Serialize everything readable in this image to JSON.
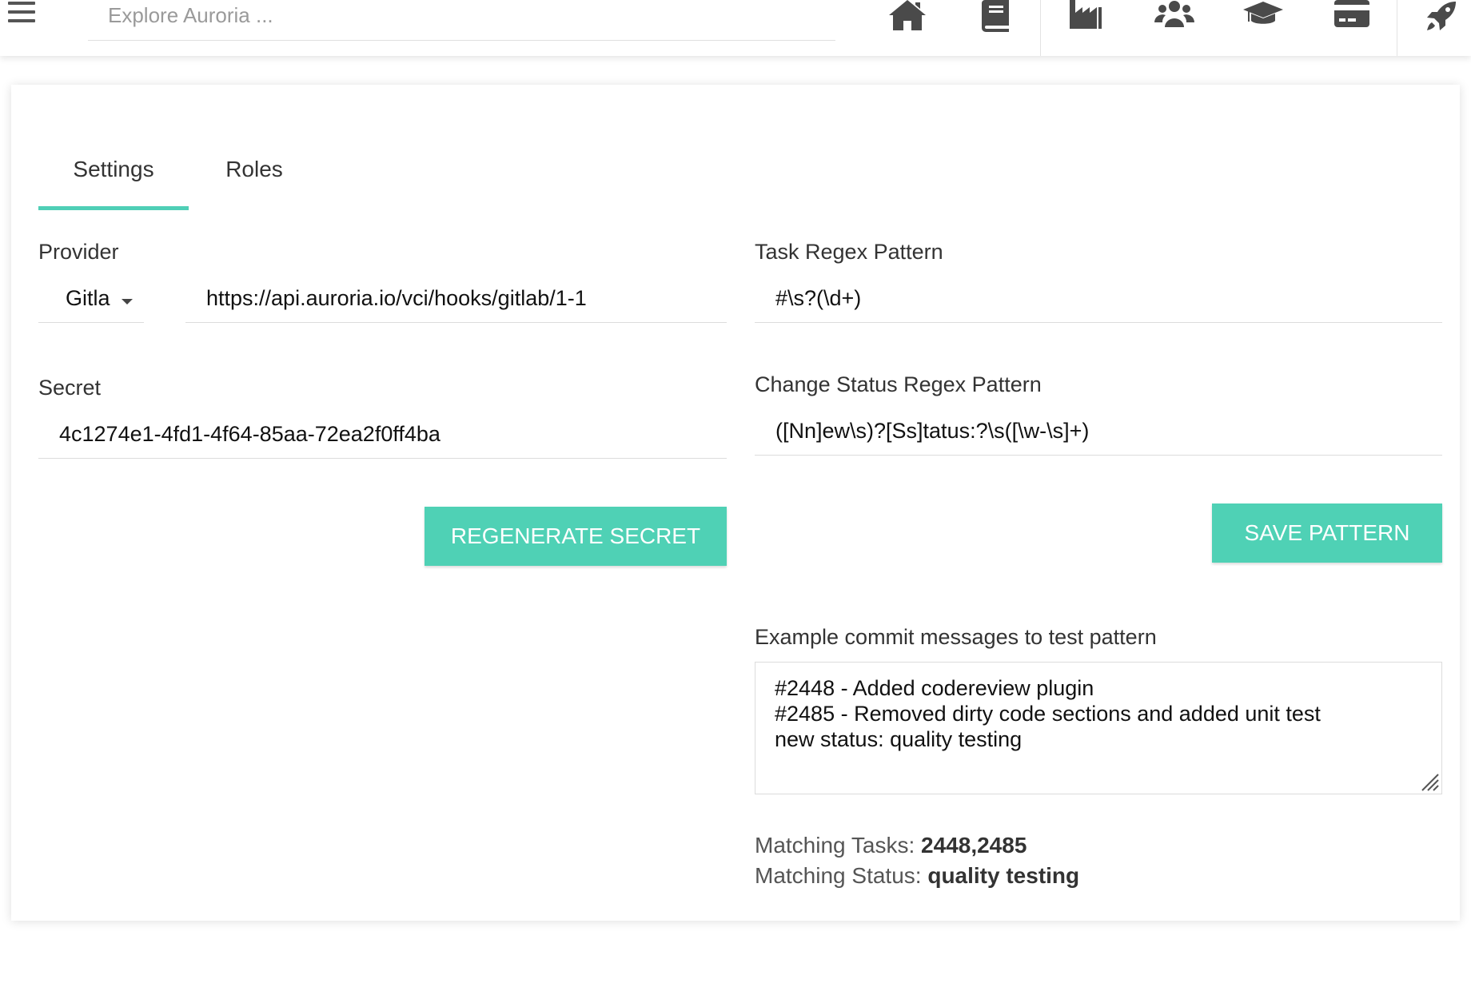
{
  "header": {
    "search_placeholder": "Explore Auroria ...",
    "nav_icons": [
      "home-icon",
      "book-icon",
      "factory-icon",
      "users-icon",
      "graduation-cap-icon",
      "credit-card-icon",
      "rocket-icon"
    ]
  },
  "tabs": [
    {
      "label": "Settings",
      "active": true
    },
    {
      "label": "Roles",
      "active": false
    }
  ],
  "left": {
    "provider_label": "Provider",
    "provider_value": "Gitla",
    "webhook_url": "https://api.auroria.io/vci/hooks/gitlab/1-1",
    "secret_label": "Secret",
    "secret_value": "4c1274e1-4fd1-4f64-85aa-72ea2f0ff4ba",
    "regenerate_label": "REGENERATE SECRET"
  },
  "right": {
    "task_regex_label": "Task Regex Pattern",
    "task_regex_value": "#\\s?(\\d+)",
    "status_regex_label": "Change Status Regex Pattern",
    "status_regex_value": "([Nn]ew\\s)?[Ss]tatus:?\\s([\\w-\\s]+)",
    "save_label": "SAVE PATTERN",
    "example_label": "Example commit messages to test pattern",
    "example_text": "#2448 - Added codereview plugin\n#2485 - Removed dirty code sections and added unit test\nnew status: quality testing",
    "matching_tasks_label": "Matching Tasks: ",
    "matching_tasks_value": "2448,2485",
    "matching_status_label": "Matching Status: ",
    "matching_status_value": "quality testing"
  },
  "colors": {
    "accent": "#4fd1b5",
    "icon": "#4a4a4a"
  }
}
